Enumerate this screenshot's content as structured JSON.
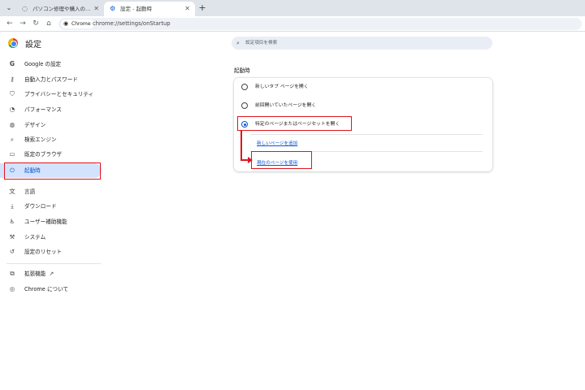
{
  "tabs": [
    {
      "title": "パソコン修理や購入のご相談 - ト…",
      "icon": "page-icon",
      "active": false
    },
    {
      "title": "設定 - 起動時",
      "icon": "gear-icon",
      "active": true
    }
  ],
  "toolbar": {
    "chip_label": "Chrome",
    "url": "chrome://settings/onStartup"
  },
  "header": {
    "title": "設定",
    "search_placeholder": "設定項目を検索"
  },
  "sidebar": {
    "items": [
      {
        "label": "Google の設定",
        "icon": "google-icon"
      },
      {
        "label": "自動入力とパスワード",
        "icon": "key-icon"
      },
      {
        "label": "プライバシーとセキュリティ",
        "icon": "shield-icon"
      },
      {
        "label": "パフォーマンス",
        "icon": "speedometer-icon"
      },
      {
        "label": "デザイン",
        "icon": "palette-icon"
      },
      {
        "label": "検索エンジン",
        "icon": "search-icon"
      },
      {
        "label": "既定のブラウザ",
        "icon": "browser-icon"
      },
      {
        "label": "起動時",
        "icon": "power-icon",
        "active": true
      },
      {
        "label": "言語",
        "icon": "translate-icon"
      },
      {
        "label": "ダウンロード",
        "icon": "download-icon"
      },
      {
        "label": "ユーザー補助機能",
        "icon": "accessibility-icon"
      },
      {
        "label": "システム",
        "icon": "wrench-icon"
      },
      {
        "label": "設定のリセット",
        "icon": "reset-icon"
      },
      {
        "label": "拡張機能",
        "icon": "puzzle-icon"
      },
      {
        "label": "Chrome について",
        "icon": "chrome-icon"
      }
    ]
  },
  "startup": {
    "section_title": "起動時",
    "options": [
      {
        "label": "新しいタブ ページを開く",
        "selected": false
      },
      {
        "label": "前回開いていたページを開く",
        "selected": false
      },
      {
        "label": "特定のページまたはページセットを開く",
        "selected": true
      }
    ],
    "add_page_link": "新しいページを追加",
    "use_current_link": "現在のページを使用"
  },
  "colors": {
    "accent": "#0b57d0",
    "highlight": "#e0161e",
    "active_nav_bg": "#d3e3fd"
  }
}
